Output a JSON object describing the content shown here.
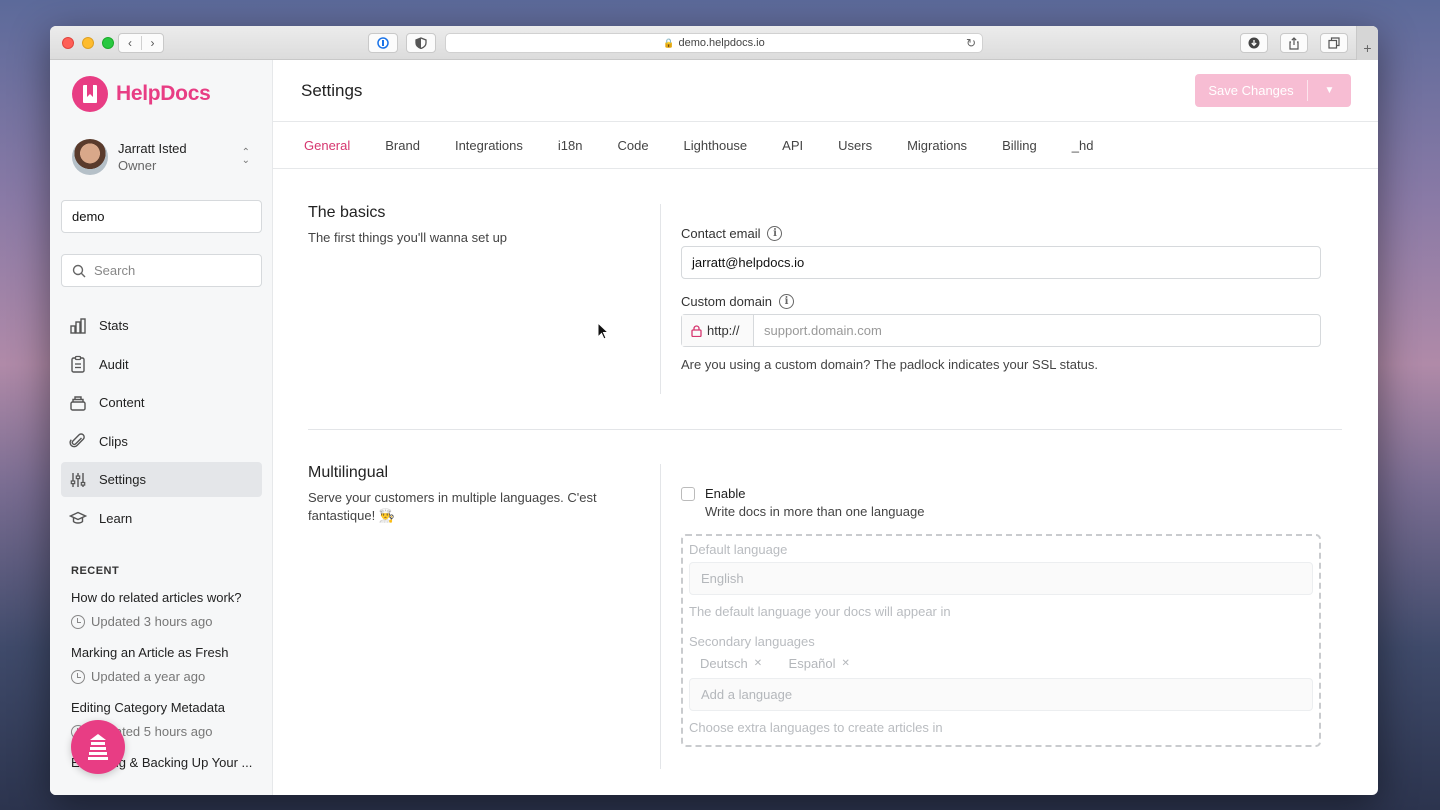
{
  "browser": {
    "url": "demo.helpdocs.io"
  },
  "brand": {
    "name": "HelpDocs",
    "accent": "#e83d84"
  },
  "user": {
    "name": "Jarratt Isted",
    "role": "Owner"
  },
  "sidebar": {
    "site_value": "demo",
    "search_placeholder": "Search",
    "nav": [
      {
        "label": "Stats",
        "icon": "bar-chart-icon"
      },
      {
        "label": "Audit",
        "icon": "clipboard-icon"
      },
      {
        "label": "Content",
        "icon": "stack-icon"
      },
      {
        "label": "Clips",
        "icon": "paperclip-icon"
      },
      {
        "label": "Settings",
        "icon": "sliders-icon"
      },
      {
        "label": "Learn",
        "icon": "graduation-cap-icon"
      }
    ],
    "recent_heading": "RECENT",
    "recent": [
      {
        "title": "How do related articles work?",
        "meta": "Updated 3 hours ago"
      },
      {
        "title": "Marking an Article as Fresh",
        "meta": "Updated a year ago"
      },
      {
        "title": "Editing Category Metadata",
        "meta": "Updated 5 hours ago"
      },
      {
        "title": "Exporting & Backing Up Your ...",
        "meta": ""
      }
    ]
  },
  "header": {
    "title": "Settings",
    "save_label": "Save Changes"
  },
  "tabs": [
    "General",
    "Brand",
    "Integrations",
    "i18n",
    "Code",
    "Lighthouse",
    "API",
    "Users",
    "Migrations",
    "Billing",
    "_hd"
  ],
  "basics": {
    "title": "The basics",
    "description": "The first things you'll wanna set up",
    "contact_label": "Contact email",
    "contact_value": "jarratt@helpdocs.io",
    "domain_label": "Custom domain",
    "domain_prefix": "http://",
    "domain_placeholder": "support.domain.com",
    "domain_help": "Are you using a custom domain? The padlock indicates your SSL status."
  },
  "multilingual": {
    "title": "Multilingual",
    "description": "Serve your customers in multiple languages. C'est fantastique! 👨‍🍳",
    "enable_label": "Enable",
    "enable_help": "Write docs in more than one language",
    "default_label": "Default language",
    "default_value": "English",
    "default_help": "The default language your docs will appear in",
    "secondary_label": "Secondary languages",
    "secondary": [
      "Deutsch",
      "Español"
    ],
    "add_placeholder": "Add a language",
    "secondary_help": "Choose extra languages to create articles in"
  }
}
